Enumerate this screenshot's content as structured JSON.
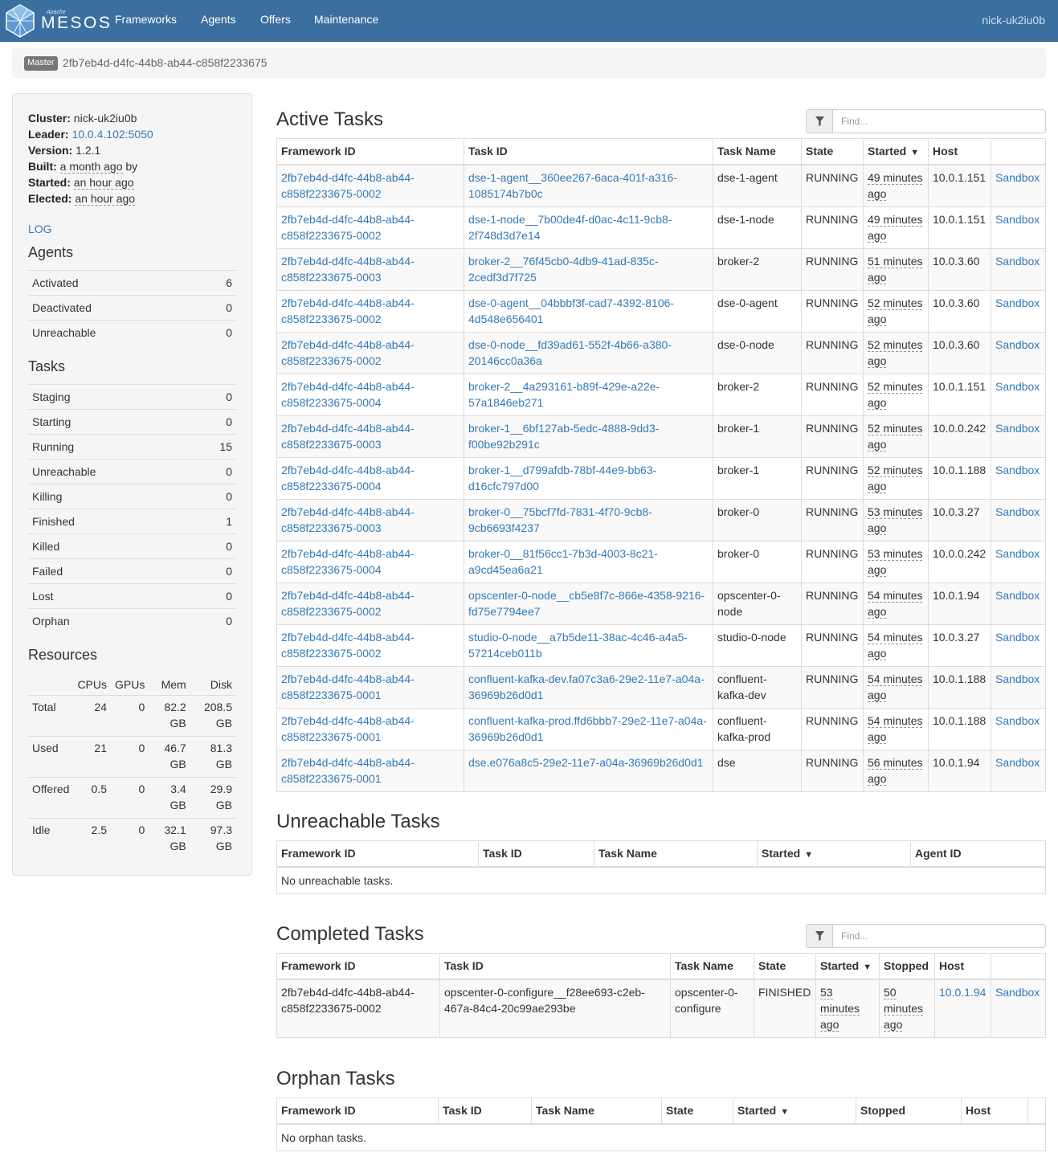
{
  "nav": {
    "brand_top": "Apache",
    "brand": "MESOS",
    "items": [
      "Frameworks",
      "Agents",
      "Offers",
      "Maintenance"
    ],
    "user": "nick-uk2iu0b"
  },
  "breadcrumb": {
    "label": "Master",
    "id": "2fb7eb4d-d4fc-44b8-ab44-c858f2233675"
  },
  "sidebar": {
    "cluster_label": "Cluster:",
    "cluster": "nick-uk2iu0b",
    "leader_label": "Leader:",
    "leader": "10.0.4.102:5050",
    "version_label": "Version:",
    "version": "1.2.1",
    "built_label": "Built:",
    "built": "a month ago",
    "built_suffix": "by",
    "started_label": "Started:",
    "started": "an hour ago",
    "elected_label": "Elected:",
    "elected": "an hour ago",
    "log": "LOG",
    "agents_title": "Agents",
    "agents": [
      {
        "label": "Activated",
        "value": "6"
      },
      {
        "label": "Deactivated",
        "value": "0"
      },
      {
        "label": "Unreachable",
        "value": "0"
      }
    ],
    "tasks_title": "Tasks",
    "tasks": [
      {
        "label": "Staging",
        "value": "0"
      },
      {
        "label": "Starting",
        "value": "0"
      },
      {
        "label": "Running",
        "value": "15"
      },
      {
        "label": "Unreachable",
        "value": "0"
      },
      {
        "label": "Killing",
        "value": "0"
      },
      {
        "label": "Finished",
        "value": "1"
      },
      {
        "label": "Killed",
        "value": "0"
      },
      {
        "label": "Failed",
        "value": "0"
      },
      {
        "label": "Lost",
        "value": "0"
      },
      {
        "label": "Orphan",
        "value": "0"
      }
    ],
    "resources_title": "Resources",
    "resources_headers": [
      "",
      "CPUs",
      "GPUs",
      "Mem",
      "Disk"
    ],
    "resources": [
      {
        "label": "Total",
        "cpus": "24",
        "gpus": "0",
        "mem": "82.2 GB",
        "disk": "208.5 GB"
      },
      {
        "label": "Used",
        "cpus": "21",
        "gpus": "0",
        "mem": "46.7 GB",
        "disk": "81.3 GB"
      },
      {
        "label": "Offered",
        "cpus": "0.5",
        "gpus": "0",
        "mem": "3.4 GB",
        "disk": "29.9 GB"
      },
      {
        "label": "Idle",
        "cpus": "2.5",
        "gpus": "0",
        "mem": "32.1 GB",
        "disk": "97.3 GB"
      }
    ]
  },
  "active": {
    "title": "Active Tasks",
    "find_placeholder": "Find...",
    "headers": [
      "Framework ID",
      "Task ID",
      "Task Name",
      "State",
      "Started",
      "Host",
      ""
    ],
    "sandbox": "Sandbox",
    "rows": [
      {
        "fw": "2fb7eb4d-d4fc-44b8-ab44-c858f2233675-0002",
        "task": "dse-1-agent__360ee267-6aca-401f-a316-1085174b7b0c",
        "name": "dse-1-agent",
        "state": "RUNNING",
        "started": "49 minutes ago",
        "host": "10.0.1.151"
      },
      {
        "fw": "2fb7eb4d-d4fc-44b8-ab44-c858f2233675-0002",
        "task": "dse-1-node__7b00de4f-d0ac-4c11-9cb8-2f748d3d7e14",
        "name": "dse-1-node",
        "state": "RUNNING",
        "started": "49 minutes ago",
        "host": "10.0.1.151"
      },
      {
        "fw": "2fb7eb4d-d4fc-44b8-ab44-c858f2233675-0003",
        "task": "broker-2__76f45cb0-4db9-41ad-835c-2cedf3d7f725",
        "name": "broker-2",
        "state": "RUNNING",
        "started": "51 minutes ago",
        "host": "10.0.3.60"
      },
      {
        "fw": "2fb7eb4d-d4fc-44b8-ab44-c858f2233675-0002",
        "task": "dse-0-agent__04bbbf3f-cad7-4392-8106-4d548e656401",
        "name": "dse-0-agent",
        "state": "RUNNING",
        "started": "52 minutes ago",
        "host": "10.0.3.60"
      },
      {
        "fw": "2fb7eb4d-d4fc-44b8-ab44-c858f2233675-0002",
        "task": "dse-0-node__fd39ad61-552f-4b66-a380-20146cc0a36a",
        "name": "dse-0-node",
        "state": "RUNNING",
        "started": "52 minutes ago",
        "host": "10.0.3.60"
      },
      {
        "fw": "2fb7eb4d-d4fc-44b8-ab44-c858f2233675-0004",
        "task": "broker-2__4a293161-b89f-429e-a22e-57a1846eb271",
        "name": "broker-2",
        "state": "RUNNING",
        "started": "52 minutes ago",
        "host": "10.0.1.151"
      },
      {
        "fw": "2fb7eb4d-d4fc-44b8-ab44-c858f2233675-0003",
        "task": "broker-1__6bf127ab-5edc-4888-9dd3-f00be92b291c",
        "name": "broker-1",
        "state": "RUNNING",
        "started": "52 minutes ago",
        "host": "10.0.0.242"
      },
      {
        "fw": "2fb7eb4d-d4fc-44b8-ab44-c858f2233675-0004",
        "task": "broker-1__d799afdb-78bf-44e9-bb63-d16cfc797d00",
        "name": "broker-1",
        "state": "RUNNING",
        "started": "52 minutes ago",
        "host": "10.0.1.188"
      },
      {
        "fw": "2fb7eb4d-d4fc-44b8-ab44-c858f2233675-0003",
        "task": "broker-0__75bcf7fd-7831-4f70-9cb8-9cb6693f4237",
        "name": "broker-0",
        "state": "RUNNING",
        "started": "53 minutes ago",
        "host": "10.0.3.27"
      },
      {
        "fw": "2fb7eb4d-d4fc-44b8-ab44-c858f2233675-0004",
        "task": "broker-0__81f56cc1-7b3d-4003-8c21-a9cd45ea6a21",
        "name": "broker-0",
        "state": "RUNNING",
        "started": "53 minutes ago",
        "host": "10.0.0.242"
      },
      {
        "fw": "2fb7eb4d-d4fc-44b8-ab44-c858f2233675-0002",
        "task": "opscenter-0-node__cb5e8f7c-866e-4358-9216-fd75e7794ee7",
        "name": "opscenter-0-node",
        "state": "RUNNING",
        "started": "54 minutes ago",
        "host": "10.0.1.94"
      },
      {
        "fw": "2fb7eb4d-d4fc-44b8-ab44-c858f2233675-0002",
        "task": "studio-0-node__a7b5de11-38ac-4c46-a4a5-57214ceb011b",
        "name": "studio-0-node",
        "state": "RUNNING",
        "started": "54 minutes ago",
        "host": "10.0.3.27"
      },
      {
        "fw": "2fb7eb4d-d4fc-44b8-ab44-c858f2233675-0001",
        "task": "confluent-kafka-dev.fa07c3a6-29e2-11e7-a04a-36969b26d0d1",
        "name": "confluent-kafka-dev",
        "state": "RUNNING",
        "started": "54 minutes ago",
        "host": "10.0.1.188"
      },
      {
        "fw": "2fb7eb4d-d4fc-44b8-ab44-c858f2233675-0001",
        "task": "confluent-kafka-prod.ffd6bbb7-29e2-11e7-a04a-36969b26d0d1",
        "name": "confluent-kafka-prod",
        "state": "RUNNING",
        "started": "54 minutes ago",
        "host": "10.0.1.188"
      },
      {
        "fw": "2fb7eb4d-d4fc-44b8-ab44-c858f2233675-0001",
        "task": "dse.e076a8c5-29e2-11e7-a04a-36969b26d0d1",
        "name": "dse",
        "state": "RUNNING",
        "started": "56 minutes ago",
        "host": "10.0.1.94"
      }
    ]
  },
  "unreachable": {
    "title": "Unreachable Tasks",
    "headers": [
      "Framework ID",
      "Task ID",
      "Task Name",
      "Started",
      "Agent ID"
    ],
    "empty": "No unreachable tasks."
  },
  "completed": {
    "title": "Completed Tasks",
    "find_placeholder": "Find...",
    "headers": [
      "Framework ID",
      "Task ID",
      "Task Name",
      "State",
      "Started",
      "Stopped",
      "Host",
      ""
    ],
    "sandbox": "Sandbox",
    "rows": [
      {
        "fw": "2fb7eb4d-d4fc-44b8-ab44-c858f2233675-0002",
        "task": "opscenter-0-configure__f28ee693-c2eb-467a-84c4-20c99ae293be",
        "name": "opscenter-0-configure",
        "state": "FINISHED",
        "started": "53 minutes ago",
        "stopped": "50 minutes ago",
        "host": "10.0.1.94"
      }
    ]
  },
  "orphan": {
    "title": "Orphan Tasks",
    "headers": [
      "Framework ID",
      "Task ID",
      "Task Name",
      "State",
      "Started",
      "Stopped",
      "Host",
      ""
    ],
    "empty": "No orphan tasks."
  },
  "sort_caret": "▼"
}
